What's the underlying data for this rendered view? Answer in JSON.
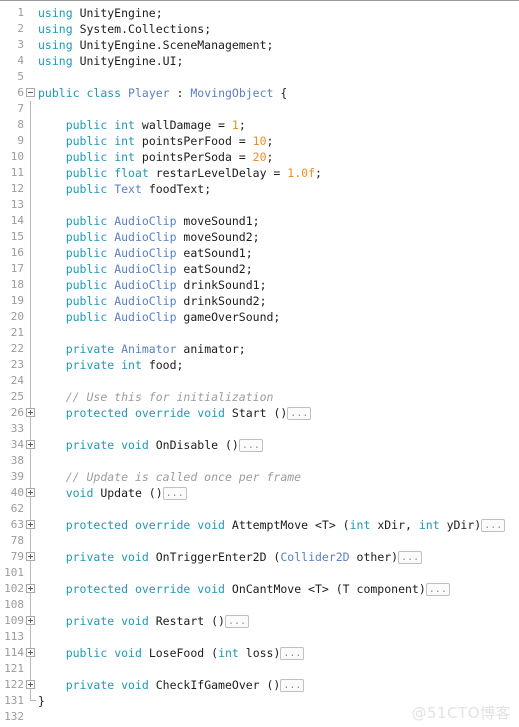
{
  "editor": {
    "language": "csharp",
    "file_title": "Player.cs",
    "colors": {
      "background": "#ffffff",
      "gutter_text": "#9b9b9b",
      "keyword": "#1f9ab0",
      "type": "#5b7fc4",
      "number": "#f08d22",
      "comment": "#9c9c9c",
      "plain": "#1c1c1c",
      "fold_border": "#c0c0c0",
      "guide_line": "#b9b9b9",
      "watermark": "#e2e2e2"
    },
    "fold_placeholder": "...",
    "watermark": "@51CTO博客",
    "total_lines_shown": 33
  },
  "lines": [
    {
      "num": "1",
      "fold": "none",
      "guide": "none",
      "indent": 0,
      "tokens": [
        {
          "t": "using",
          "c": "kw"
        },
        {
          "t": " ",
          "c": "pun"
        },
        {
          "t": "UnityEngine",
          "c": "id"
        },
        {
          "t": ";",
          "c": "pun"
        }
      ]
    },
    {
      "num": "2",
      "fold": "none",
      "guide": "none",
      "indent": 0,
      "tokens": [
        {
          "t": "using",
          "c": "kw"
        },
        {
          "t": " ",
          "c": "pun"
        },
        {
          "t": "System.Collections",
          "c": "id"
        },
        {
          "t": ";",
          "c": "pun"
        }
      ]
    },
    {
      "num": "3",
      "fold": "none",
      "guide": "none",
      "indent": 0,
      "tokens": [
        {
          "t": "using",
          "c": "kw"
        },
        {
          "t": " ",
          "c": "pun"
        },
        {
          "t": "UnityEngine.SceneManagement",
          "c": "id"
        },
        {
          "t": ";",
          "c": "pun"
        }
      ]
    },
    {
      "num": "4",
      "fold": "none",
      "guide": "none",
      "indent": 0,
      "tokens": [
        {
          "t": "using",
          "c": "kw"
        },
        {
          "t": " ",
          "c": "pun"
        },
        {
          "t": "UnityEngine.UI",
          "c": "id"
        },
        {
          "t": ";",
          "c": "pun"
        }
      ]
    },
    {
      "num": "5",
      "fold": "none",
      "guide": "none",
      "indent": 0,
      "tokens": []
    },
    {
      "num": "6",
      "fold": "minus",
      "guide": "none",
      "indent": 0,
      "tokens": [
        {
          "t": "public",
          "c": "kw"
        },
        {
          "t": " ",
          "c": "pun"
        },
        {
          "t": "class",
          "c": "kw"
        },
        {
          "t": " ",
          "c": "pun"
        },
        {
          "t": "Player",
          "c": "type"
        },
        {
          "t": " : ",
          "c": "pun"
        },
        {
          "t": "MovingObject",
          "c": "type"
        },
        {
          "t": " {",
          "c": "pun"
        }
      ]
    },
    {
      "num": "7",
      "fold": "none",
      "guide": "full",
      "indent": 0,
      "tokens": []
    },
    {
      "num": "8",
      "fold": "none",
      "guide": "full",
      "indent": 4,
      "tokens": [
        {
          "t": "public",
          "c": "kw"
        },
        {
          "t": " ",
          "c": "pun"
        },
        {
          "t": "int",
          "c": "kw"
        },
        {
          "t": " wallDamage = ",
          "c": "pun"
        },
        {
          "t": "1",
          "c": "num"
        },
        {
          "t": ";",
          "c": "pun"
        }
      ]
    },
    {
      "num": "9",
      "fold": "none",
      "guide": "full",
      "indent": 4,
      "tokens": [
        {
          "t": "public",
          "c": "kw"
        },
        {
          "t": " ",
          "c": "pun"
        },
        {
          "t": "int",
          "c": "kw"
        },
        {
          "t": " pointsPerFood = ",
          "c": "pun"
        },
        {
          "t": "10",
          "c": "num"
        },
        {
          "t": ";",
          "c": "pun"
        }
      ]
    },
    {
      "num": "10",
      "fold": "none",
      "guide": "full",
      "indent": 4,
      "tokens": [
        {
          "t": "public",
          "c": "kw"
        },
        {
          "t": " ",
          "c": "pun"
        },
        {
          "t": "int",
          "c": "kw"
        },
        {
          "t": " pointsPerSoda = ",
          "c": "pun"
        },
        {
          "t": "20",
          "c": "num"
        },
        {
          "t": ";",
          "c": "pun"
        }
      ]
    },
    {
      "num": "11",
      "fold": "none",
      "guide": "full",
      "indent": 4,
      "tokens": [
        {
          "t": "public",
          "c": "kw"
        },
        {
          "t": " ",
          "c": "pun"
        },
        {
          "t": "float",
          "c": "kw"
        },
        {
          "t": " restarLevelDelay = ",
          "c": "pun"
        },
        {
          "t": "1.0f",
          "c": "num"
        },
        {
          "t": ";",
          "c": "pun"
        }
      ]
    },
    {
      "num": "12",
      "fold": "none",
      "guide": "full",
      "indent": 4,
      "tokens": [
        {
          "t": "public",
          "c": "kw"
        },
        {
          "t": " ",
          "c": "pun"
        },
        {
          "t": "Text",
          "c": "type"
        },
        {
          "t": " foodText;",
          "c": "pun"
        }
      ]
    },
    {
      "num": "13",
      "fold": "none",
      "guide": "full",
      "indent": 0,
      "tokens": []
    },
    {
      "num": "14",
      "fold": "none",
      "guide": "full",
      "indent": 4,
      "tokens": [
        {
          "t": "public",
          "c": "kw"
        },
        {
          "t": " ",
          "c": "pun"
        },
        {
          "t": "AudioClip",
          "c": "type"
        },
        {
          "t": " moveSound1;",
          "c": "pun"
        }
      ]
    },
    {
      "num": "15",
      "fold": "none",
      "guide": "full",
      "indent": 4,
      "tokens": [
        {
          "t": "public",
          "c": "kw"
        },
        {
          "t": " ",
          "c": "pun"
        },
        {
          "t": "AudioClip",
          "c": "type"
        },
        {
          "t": " moveSound2;",
          "c": "pun"
        }
      ]
    },
    {
      "num": "16",
      "fold": "none",
      "guide": "full",
      "indent": 4,
      "tokens": [
        {
          "t": "public",
          "c": "kw"
        },
        {
          "t": " ",
          "c": "pun"
        },
        {
          "t": "AudioClip",
          "c": "type"
        },
        {
          "t": " eatSound1;",
          "c": "pun"
        }
      ]
    },
    {
      "num": "17",
      "fold": "none",
      "guide": "full",
      "indent": 4,
      "tokens": [
        {
          "t": "public",
          "c": "kw"
        },
        {
          "t": " ",
          "c": "pun"
        },
        {
          "t": "AudioClip",
          "c": "type"
        },
        {
          "t": " eatSound2;",
          "c": "pun"
        }
      ]
    },
    {
      "num": "18",
      "fold": "none",
      "guide": "full",
      "indent": 4,
      "tokens": [
        {
          "t": "public",
          "c": "kw"
        },
        {
          "t": " ",
          "c": "pun"
        },
        {
          "t": "AudioClip",
          "c": "type"
        },
        {
          "t": " drinkSound1;",
          "c": "pun"
        }
      ]
    },
    {
      "num": "19",
      "fold": "none",
      "guide": "full",
      "indent": 4,
      "tokens": [
        {
          "t": "public",
          "c": "kw"
        },
        {
          "t": " ",
          "c": "pun"
        },
        {
          "t": "AudioClip",
          "c": "type"
        },
        {
          "t": " drinkSound2;",
          "c": "pun"
        }
      ]
    },
    {
      "num": "20",
      "fold": "none",
      "guide": "full",
      "indent": 4,
      "tokens": [
        {
          "t": "public",
          "c": "kw"
        },
        {
          "t": " ",
          "c": "pun"
        },
        {
          "t": "AudioClip",
          "c": "type"
        },
        {
          "t": " gameOverSound;",
          "c": "pun"
        }
      ]
    },
    {
      "num": "21",
      "fold": "none",
      "guide": "full",
      "indent": 0,
      "tokens": []
    },
    {
      "num": "22",
      "fold": "none",
      "guide": "full",
      "indent": 4,
      "tokens": [
        {
          "t": "private",
          "c": "kw"
        },
        {
          "t": " ",
          "c": "pun"
        },
        {
          "t": "Animator",
          "c": "type"
        },
        {
          "t": " animator;",
          "c": "pun"
        }
      ]
    },
    {
      "num": "23",
      "fold": "none",
      "guide": "full",
      "indent": 4,
      "tokens": [
        {
          "t": "private",
          "c": "kw"
        },
        {
          "t": " ",
          "c": "pun"
        },
        {
          "t": "int",
          "c": "kw"
        },
        {
          "t": " food;",
          "c": "pun"
        }
      ]
    },
    {
      "num": "24",
      "fold": "none",
      "guide": "full",
      "indent": 0,
      "tokens": []
    },
    {
      "num": "25",
      "fold": "none",
      "guide": "full",
      "indent": 4,
      "tokens": [
        {
          "t": "// Use this for initialization",
          "c": "cmt"
        }
      ]
    },
    {
      "num": "26",
      "fold": "plus",
      "guide": "full",
      "indent": 4,
      "tokens": [
        {
          "t": "protected",
          "c": "kw"
        },
        {
          "t": " ",
          "c": "pun"
        },
        {
          "t": "override",
          "c": "kw"
        },
        {
          "t": " ",
          "c": "pun"
        },
        {
          "t": "void",
          "c": "kw"
        },
        {
          "t": " Start ()",
          "c": "pun"
        }
      ],
      "fold_inline": true
    },
    {
      "num": "33",
      "fold": "none",
      "guide": "full",
      "indent": 0,
      "tokens": []
    },
    {
      "num": "34",
      "fold": "plus",
      "guide": "full",
      "indent": 4,
      "tokens": [
        {
          "t": "private",
          "c": "kw"
        },
        {
          "t": " ",
          "c": "pun"
        },
        {
          "t": "void",
          "c": "kw"
        },
        {
          "t": " OnDisable ()",
          "c": "pun"
        }
      ],
      "fold_inline": true
    },
    {
      "num": "38",
      "fold": "none",
      "guide": "full",
      "indent": 0,
      "tokens": []
    },
    {
      "num": "39",
      "fold": "none",
      "guide": "full",
      "indent": 4,
      "tokens": [
        {
          "t": "// Update is called once per frame",
          "c": "cmt"
        }
      ]
    },
    {
      "num": "40",
      "fold": "plus",
      "guide": "full",
      "indent": 4,
      "tokens": [
        {
          "t": "void",
          "c": "kw"
        },
        {
          "t": " Update ()",
          "c": "pun"
        }
      ],
      "fold_inline": true
    },
    {
      "num": "62",
      "fold": "none",
      "guide": "full",
      "indent": 0,
      "tokens": []
    },
    {
      "num": "63",
      "fold": "plus",
      "guide": "full",
      "indent": 4,
      "tokens": [
        {
          "t": "protected",
          "c": "kw"
        },
        {
          "t": " ",
          "c": "pun"
        },
        {
          "t": "override",
          "c": "kw"
        },
        {
          "t": " ",
          "c": "pun"
        },
        {
          "t": "void",
          "c": "kw"
        },
        {
          "t": " AttemptMove <T> (",
          "c": "pun"
        },
        {
          "t": "int",
          "c": "kw"
        },
        {
          "t": " xDir, ",
          "c": "pun"
        },
        {
          "t": "int",
          "c": "kw"
        },
        {
          "t": " yDir)",
          "c": "pun"
        }
      ],
      "fold_inline": true
    },
    {
      "num": "78",
      "fold": "none",
      "guide": "full",
      "indent": 0,
      "tokens": []
    },
    {
      "num": "79",
      "fold": "plus",
      "guide": "full",
      "indent": 4,
      "tokens": [
        {
          "t": "private",
          "c": "kw"
        },
        {
          "t": " ",
          "c": "pun"
        },
        {
          "t": "void",
          "c": "kw"
        },
        {
          "t": " OnTriggerEnter2D (",
          "c": "pun"
        },
        {
          "t": "Collider2D",
          "c": "type"
        },
        {
          "t": " other)",
          "c": "pun"
        }
      ],
      "fold_inline": true
    },
    {
      "num": "101",
      "fold": "none",
      "guide": "full",
      "indent": 0,
      "tokens": []
    },
    {
      "num": "102",
      "fold": "plus",
      "guide": "full",
      "indent": 4,
      "tokens": [
        {
          "t": "protected",
          "c": "kw"
        },
        {
          "t": " ",
          "c": "pun"
        },
        {
          "t": "override",
          "c": "kw"
        },
        {
          "t": " ",
          "c": "pun"
        },
        {
          "t": "void",
          "c": "kw"
        },
        {
          "t": " OnCantMove <T> (T component)",
          "c": "pun"
        }
      ],
      "fold_inline": true
    },
    {
      "num": "108",
      "fold": "none",
      "guide": "full",
      "indent": 0,
      "tokens": []
    },
    {
      "num": "109",
      "fold": "plus",
      "guide": "full",
      "indent": 4,
      "tokens": [
        {
          "t": "private",
          "c": "kw"
        },
        {
          "t": " ",
          "c": "pun"
        },
        {
          "t": "void",
          "c": "kw"
        },
        {
          "t": " Restart ()",
          "c": "pun"
        }
      ],
      "fold_inline": true
    },
    {
      "num": "113",
      "fold": "none",
      "guide": "full",
      "indent": 0,
      "tokens": []
    },
    {
      "num": "114",
      "fold": "plus",
      "guide": "full",
      "indent": 4,
      "tokens": [
        {
          "t": "public",
          "c": "kw"
        },
        {
          "t": " ",
          "c": "pun"
        },
        {
          "t": "void",
          "c": "kw"
        },
        {
          "t": " LoseFood (",
          "c": "pun"
        },
        {
          "t": "int",
          "c": "kw"
        },
        {
          "t": " loss)",
          "c": "pun"
        }
      ],
      "fold_inline": true
    },
    {
      "num": "121",
      "fold": "none",
      "guide": "full",
      "indent": 0,
      "tokens": []
    },
    {
      "num": "122",
      "fold": "plus",
      "guide": "full",
      "indent": 4,
      "tokens": [
        {
          "t": "private",
          "c": "kw"
        },
        {
          "t": " ",
          "c": "pun"
        },
        {
          "t": "void",
          "c": "kw"
        },
        {
          "t": " CheckIfGameOver ()",
          "c": "pun"
        }
      ],
      "fold_inline": true
    },
    {
      "num": "131",
      "fold": "none",
      "guide": "elbow",
      "indent": 0,
      "tokens": [
        {
          "t": "}",
          "c": "pun"
        }
      ]
    },
    {
      "num": "132",
      "fold": "none",
      "guide": "none",
      "indent": 0,
      "tokens": []
    }
  ]
}
